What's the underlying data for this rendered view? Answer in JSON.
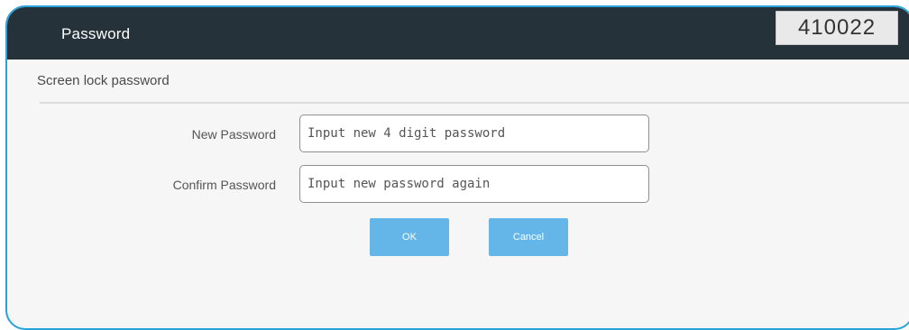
{
  "dialog": {
    "title": "Password",
    "code": "410022",
    "accent_border": "#29a3dc",
    "titlebar_color": "#26323a"
  },
  "section": {
    "title": "Screen lock password"
  },
  "form": {
    "new_password": {
      "label": "New Password",
      "placeholder": "Input new 4 digit password",
      "value": ""
    },
    "confirm_password": {
      "label": "Confirm Password",
      "placeholder": "Input new password again",
      "value": ""
    }
  },
  "buttons": {
    "ok_label": "OK",
    "cancel_label": "Cancel",
    "color": "#64b5e8"
  }
}
